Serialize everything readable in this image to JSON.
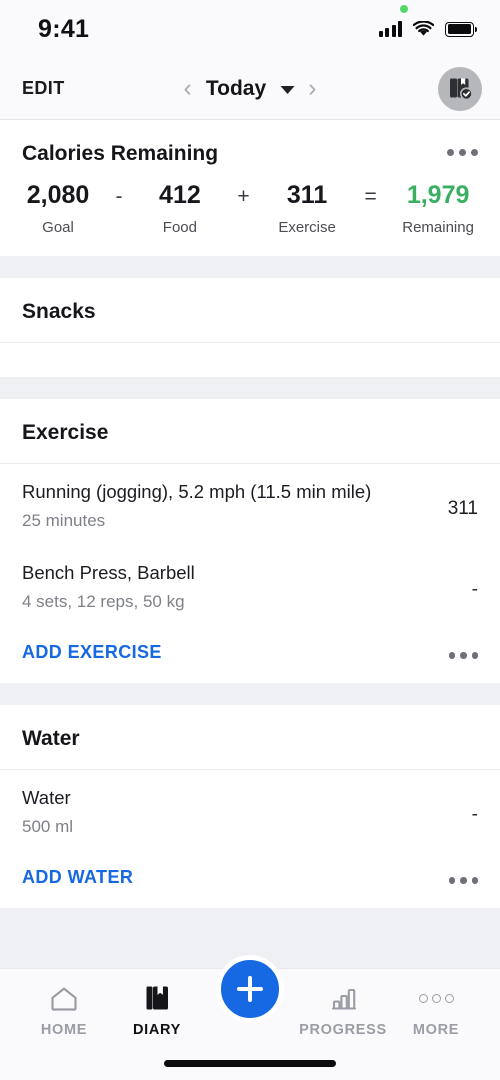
{
  "status_bar": {
    "time": "9:41",
    "icons": [
      "signal-icon",
      "wifi-icon",
      "battery-icon"
    ],
    "recording_indicator": "green-dot"
  },
  "nav": {
    "edit_label": "EDIT",
    "date_label": "Today",
    "prev_icon": "chevron-left-icon",
    "next_icon": "chevron-right-icon",
    "dropdown_icon": "chevron-down-icon",
    "avatar_icon": "diary-check-avatar-icon"
  },
  "summary": {
    "title": "Calories Remaining",
    "menu_icon": "overflow-menu-icon",
    "goal_value": "2,080",
    "goal_label": "Goal",
    "op_minus": "-",
    "food_value": "412",
    "food_label": "Food",
    "op_plus": "+",
    "exercise_value": "311",
    "exercise_label": "Exercise",
    "op_equals": "=",
    "remaining_value": "1,979",
    "remaining_label": "Remaining",
    "remaining_color": "#3aaf62"
  },
  "snacks": {
    "title": "Snacks"
  },
  "exercise": {
    "title": "Exercise",
    "entries": [
      {
        "title": "Running (jogging), 5.2 mph (11.5 min mile)",
        "sub": "25 minutes",
        "value": "311"
      },
      {
        "title": "Bench Press, Barbell",
        "sub": "4 sets, 12 reps, 50 kg",
        "value": "-"
      }
    ],
    "action_label": "ADD EXERCISE",
    "menu_icon": "overflow-menu-icon"
  },
  "water": {
    "title": "Water",
    "entries": [
      {
        "title": "Water",
        "sub": "500 ml",
        "value": "-"
      }
    ],
    "action_label": "ADD WATER",
    "menu_icon": "overflow-menu-icon"
  },
  "tabbar": {
    "tabs": [
      {
        "label": "HOME",
        "icon": "home-icon",
        "active": false
      },
      {
        "label": "DIARY",
        "icon": "diary-book-icon",
        "active": true
      },
      {
        "label": "PROGRESS",
        "icon": "bar-chart-icon",
        "active": false
      },
      {
        "label": "MORE",
        "icon": "more-dots-icon",
        "active": false
      }
    ],
    "fab_icon": "plus-icon",
    "accent_color": "#1668e3"
  }
}
